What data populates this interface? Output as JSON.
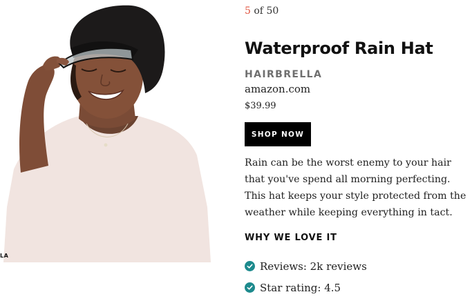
{
  "gallery": {
    "current": "5",
    "separator": " of ",
    "total": "50"
  },
  "product": {
    "title": "Waterproof Rain Hat",
    "brand": "HAIRBRELLA",
    "store": "amazon.com",
    "price": "$39.99"
  },
  "shop_button": {
    "label": "SHOP NOW"
  },
  "description": "Rain can be the worst enemy to your hair that you've spend all morning perfecting. This hat keeps your style protected from the weather while keeping everything in tact.",
  "why_we_love_it": {
    "heading": "WHY WE LOVE IT",
    "items": [
      {
        "icon": "check-circle-icon",
        "text": "Reviews: 2k reviews"
      },
      {
        "icon": "check-circle-icon",
        "text": "Star rating: 4.5"
      }
    ]
  },
  "photo": {
    "credit": "LA"
  },
  "colors": {
    "accent_counter": "#e0533f",
    "check_icon": "#1d8a8d",
    "button_bg": "#000000",
    "brand_gray": "#6f6f6f"
  }
}
